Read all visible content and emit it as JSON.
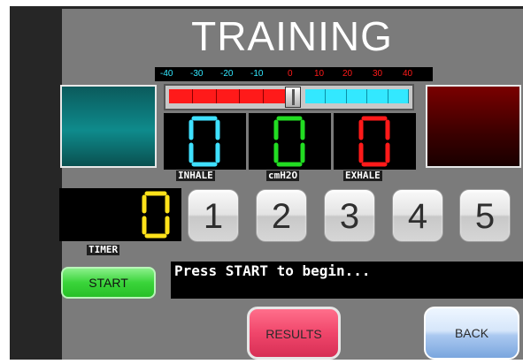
{
  "title": "TRAINING",
  "scale": {
    "ticks": [
      "-40",
      "-30",
      "-20",
      "-10",
      "0",
      "10",
      "20",
      "30",
      "40"
    ],
    "negative_color": "#33e8ff",
    "positive_color": "#ff1a1a"
  },
  "displays": {
    "inhale": {
      "value": "0",
      "label": "INHALE",
      "color": "#3fe0ff"
    },
    "pressure": {
      "value": "0",
      "label": "cmH2O",
      "color": "#22dd22"
    },
    "exhale": {
      "value": "0",
      "label": "EXHALE",
      "color": "#ff1a1a"
    },
    "timer": {
      "value": "0",
      "label": "TIMER",
      "color": "#ffe21a"
    }
  },
  "level_buttons": [
    "1",
    "2",
    "3",
    "4",
    "5"
  ],
  "start_label": "START",
  "message": "Press START to begin...",
  "results_label": "RESULTS",
  "back_label": "BACK",
  "colors": {
    "inhale_panel": "#0e8b8c",
    "exhale_panel": "#7a0000",
    "start": "#3ad43a",
    "results": "#f0466b",
    "back": "#aac8f0"
  }
}
